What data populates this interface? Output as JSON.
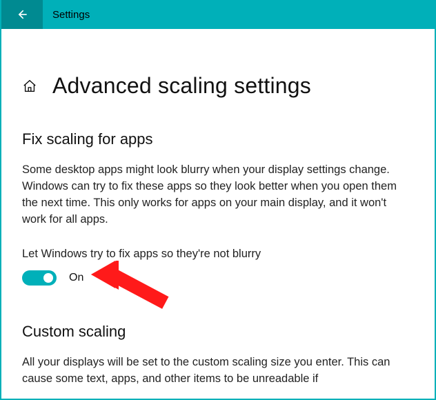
{
  "titlebar": {
    "label": "Settings"
  },
  "page": {
    "title": "Advanced scaling settings"
  },
  "section1": {
    "heading": "Fix scaling for apps",
    "description": "Some desktop apps might look blurry when your display settings change. Windows can try to fix these apps so they look better when you open them the next time. This only works for apps on your main display, and it won't work for all apps.",
    "option_label": "Let Windows try to fix apps so they're not blurry",
    "toggle_state": "On"
  },
  "section2": {
    "heading": "Custom scaling",
    "description": "All your displays will be set to the custom scaling size you enter. This can cause some text, apps, and other items to be unreadable if"
  },
  "colors": {
    "accent": "#00b0b9",
    "accent_dark": "#008a91",
    "arrow": "#ff1a1a"
  }
}
